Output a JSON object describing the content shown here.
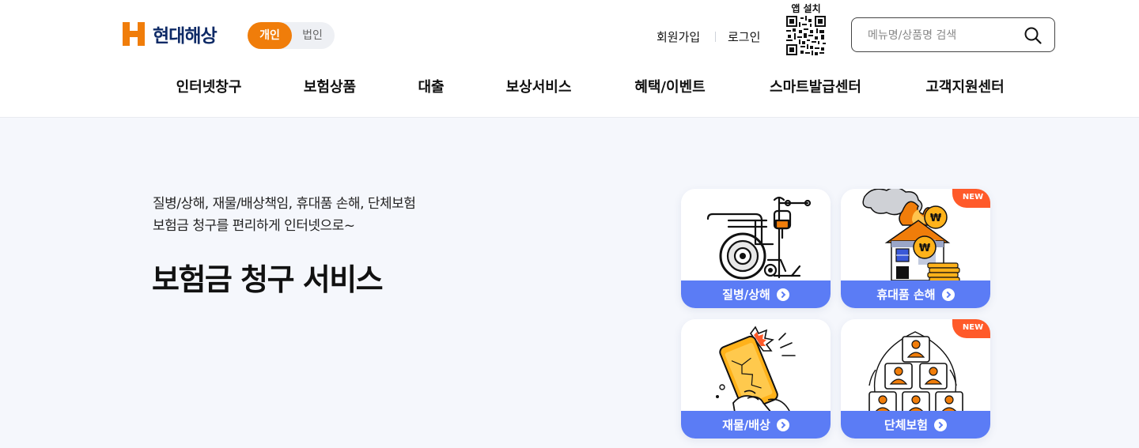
{
  "brand": {
    "name": "현대해상"
  },
  "segment": {
    "personal": "개인",
    "corporate": "법인",
    "selected": "개인"
  },
  "util": {
    "signup": "회원가입",
    "login": "로그인",
    "app_install": "앱 설치"
  },
  "search": {
    "placeholder": "메뉴명/상품명 검색",
    "value": ""
  },
  "gnb": [
    {
      "label": "인터넷창구"
    },
    {
      "label": "보험상품"
    },
    {
      "label": "대출"
    },
    {
      "label": "보상서비스"
    },
    {
      "label": "혜택/이벤트"
    },
    {
      "label": "스마트발급센터"
    },
    {
      "label": "고객지원센터"
    }
  ],
  "hero": {
    "sub_line1": "질병/상해, 재물/배상책임, 휴대품 손해, 단체보험",
    "sub_line2": "보험금 청구를 편리하게 인터넷으로~",
    "title": "보험금 청구 서비스"
  },
  "cards": [
    {
      "label": "질병/상해",
      "badge": "",
      "icon": "wheelchair-iv-icon"
    },
    {
      "label": "휴대품 손해",
      "badge": "NEW",
      "icon": "house-fire-coins-icon"
    },
    {
      "label": "재물/배상",
      "badge": "",
      "icon": "broken-phone-icon"
    },
    {
      "label": "단체보험",
      "badge": "NEW",
      "icon": "group-people-icon"
    }
  ],
  "colors": {
    "brand_orange": "#f07d0a",
    "card_blue": "#5b7cf5",
    "badge_red": "#ff5a2a",
    "hero_bg": "#f5f7fc",
    "logo_navy": "#0e2a66"
  }
}
